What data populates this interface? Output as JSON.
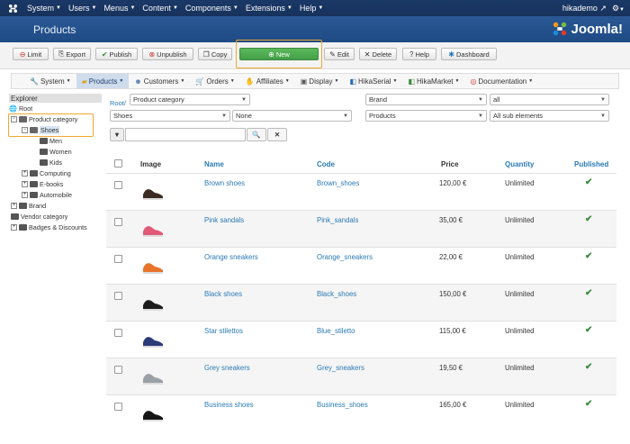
{
  "topnav": {
    "items": [
      "System",
      "Users",
      "Menus",
      "Content",
      "Components",
      "Extensions",
      "Help"
    ],
    "user": "hikademo"
  },
  "header": {
    "title": "Products",
    "brand": "Joomla!"
  },
  "toolbar": {
    "limit": "Limit",
    "export": "Export",
    "publish": "Publish",
    "unpublish": "Unpublish",
    "copy": "Copy",
    "new": "New",
    "edit": "Edit",
    "delete": "Delete",
    "help": "Help",
    "dashboard": "Dashboard"
  },
  "menubar": {
    "items": [
      "System",
      "Products",
      "Customers",
      "Orders",
      "Affiliates",
      "Display",
      "HikaSerial",
      "HikaMarket",
      "Documentation"
    ]
  },
  "explorer": {
    "header": "Explorer",
    "root": "Root",
    "product_category": "Product category",
    "shoes": "Shoes",
    "men": "Men",
    "women": "Women",
    "kids": "Kids",
    "computing": "Computing",
    "ebooks": "E-books",
    "automobile": "Automobile",
    "brand": "Brand",
    "vendor_category": "Vendor category",
    "badges": "Badges & Discounts"
  },
  "filters": {
    "root_link": "Root/",
    "product_category": "Product category",
    "brand": "Brand",
    "all": "all",
    "shoes": "Shoes",
    "none": "None",
    "products": "Products",
    "all_sub": "All sub elements",
    "search_placeholder": ""
  },
  "table": {
    "headers": {
      "image": "Image",
      "name": "Name",
      "code": "Code",
      "price": "Price",
      "quantity": "Quantity",
      "published": "Published"
    },
    "rows": [
      {
        "name": "Brown shoes",
        "code": "Brown_shoes",
        "price": "120,00 €",
        "quantity": "Unlimited",
        "published": true,
        "shoe_color": "#3a2a22"
      },
      {
        "name": "Pink sandals",
        "code": "Pink_sandals",
        "price": "35,00 €",
        "quantity": "Unlimited",
        "published": true,
        "shoe_color": "#e05a78"
      },
      {
        "name": "Orange sneakers",
        "code": "Orange_sneakers",
        "price": "22,00 €",
        "quantity": "Unlimited",
        "published": true,
        "shoe_color": "#e8742a"
      },
      {
        "name": "Black shoes",
        "code": "Black_shoes",
        "price": "150,00 €",
        "quantity": "Unlimited",
        "published": true,
        "shoe_color": "#1e1e1e"
      },
      {
        "name": "Star stilettos",
        "code": "Blue_stiletto",
        "price": "115,00 €",
        "quantity": "Unlimited",
        "published": true,
        "shoe_color": "#2c3c7a"
      },
      {
        "name": "Grey sneakers",
        "code": "Grey_sneakers",
        "price": "19,50 €",
        "quantity": "Unlimited",
        "published": true,
        "shoe_color": "#9aa0a6"
      },
      {
        "name": "Business shoes",
        "code": "Business_shoes",
        "price": "165,00 €",
        "quantity": "Unlimited",
        "published": true,
        "shoe_color": "#151515"
      }
    ]
  },
  "colors": {
    "accent_blue": "#2a7ab5",
    "highlight_orange": "#f0a830",
    "published_green": "#3c8a3c",
    "header_blue": "#1e4b84"
  }
}
